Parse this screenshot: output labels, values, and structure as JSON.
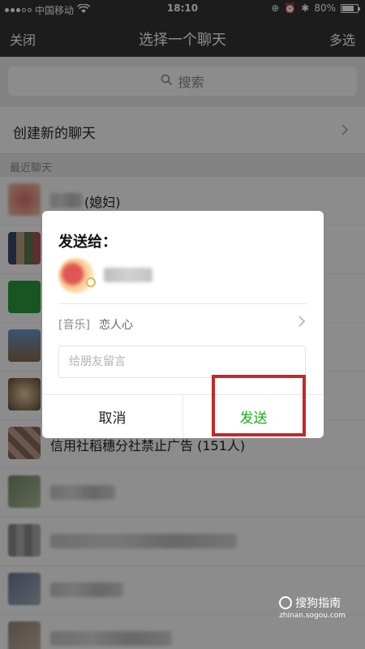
{
  "status_bar": {
    "carrier": "中国移动",
    "time": "18:10",
    "battery": "80%",
    "battery_level": 0.8
  },
  "nav": {
    "left_label": "关闭",
    "title": "选择一个聊天",
    "right_label": "多选"
  },
  "search": {
    "placeholder": "搜索"
  },
  "create_new_chat": "创建新的聊天",
  "section_header": "最近聊天",
  "chat_list": [
    {
      "name": "(媳妇)",
      "avatar_color": "#e8a0a0"
    },
    {
      "name": "",
      "avatar_color": "#4a6b8a"
    },
    {
      "name": "",
      "avatar_color": "#2c9b3e"
    },
    {
      "name": "",
      "avatar_color": "#4f7fb0"
    },
    {
      "name": "",
      "avatar_color": "#caa27a"
    },
    {
      "name": "信用社稻穗分社禁止广告 (151人)",
      "avatar_color": "#8a6a5a"
    },
    {
      "name": "",
      "avatar_color": "#7a8a6a"
    },
    {
      "name": "",
      "avatar_color": "#8c8c8c"
    },
    {
      "name": "",
      "avatar_color": "#6a7a9a"
    },
    {
      "name": "",
      "avatar_color": "#9a8a7a"
    }
  ],
  "dialog": {
    "title": "发送给：",
    "recipient_name": "",
    "music_tag": "[音乐]",
    "music_title": "恋人心",
    "message_placeholder": "给朋友留言",
    "cancel_label": "取消",
    "send_label": "发送",
    "send_color": "#1aad19"
  },
  "watermark": {
    "brand": "搜狗指南",
    "url": "zhinan.sogou.com"
  }
}
